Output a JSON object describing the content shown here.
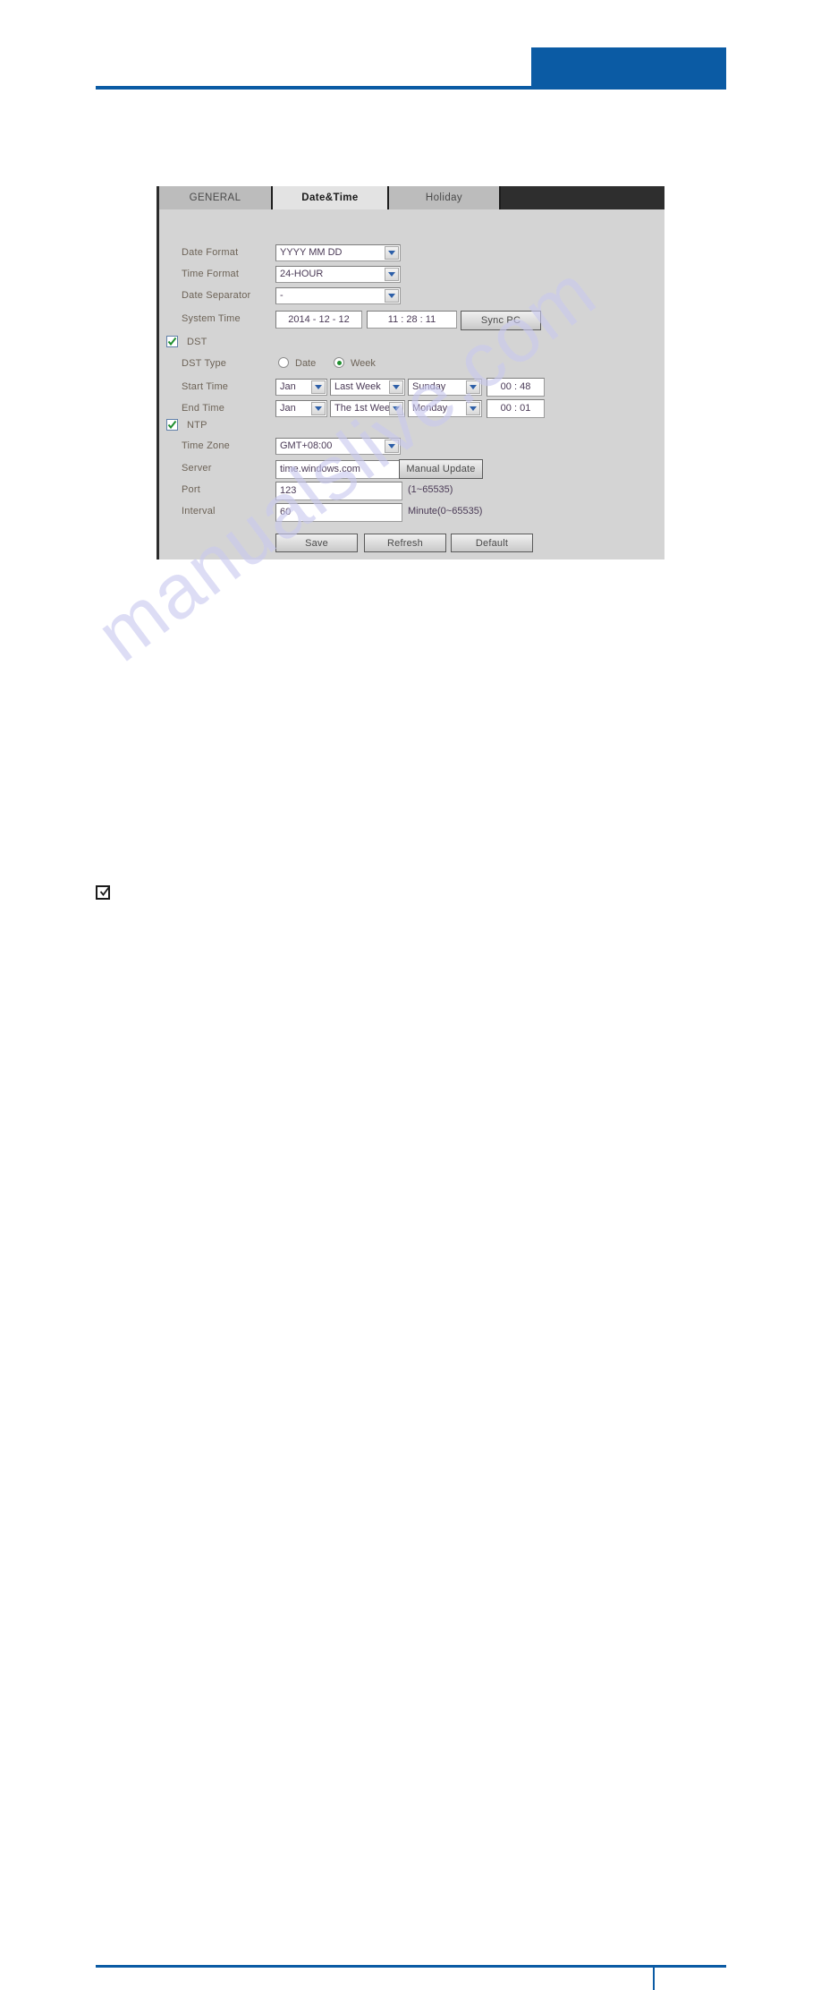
{
  "header": {
    "accent_color": "#0b5ba4"
  },
  "watermark": {
    "text": "manualslive.com"
  },
  "note": {
    "marker_icon": "checked-box-icon"
  },
  "ui": {
    "tabs": [
      {
        "label": "GENERAL",
        "active": false
      },
      {
        "label": "Date&Time",
        "active": true
      },
      {
        "label": "Holiday",
        "active": false
      }
    ],
    "fields": {
      "date_format_label": "Date Format",
      "date_format_value": "YYYY MM DD",
      "time_format_label": "Time Format",
      "time_format_value": "24-HOUR",
      "date_separator_label": "Date Separator",
      "date_separator_value": "-",
      "system_time_label": "System Time",
      "system_date_value": "2014 - 12 - 12",
      "system_clock_value": "11  :  28  :  11",
      "sync_pc_label": "Sync PC",
      "dst_label": "DST",
      "dst_checked": true,
      "dst_type_label": "DST Type",
      "dst_type_date_label": "Date",
      "dst_type_week_label": "Week",
      "dst_type_selected": "Week",
      "start_time_label": "Start Time",
      "start_month": "Jan",
      "start_week": "Last Week",
      "start_day": "Sunday",
      "start_clock": "00  :  48",
      "end_time_label": "End Time",
      "end_month": "Jan",
      "end_week": "The 1st Week",
      "end_day": "Monday",
      "end_clock": "00  :  01",
      "ntp_label": "NTP",
      "ntp_checked": true,
      "time_zone_label": "Time Zone",
      "time_zone_value": "GMT+08:00",
      "server_label": "Server",
      "server_value": "time.windows.com",
      "manual_update_label": "Manual Update",
      "port_label": "Port",
      "port_value": "123",
      "port_hint": "(1~65535)",
      "interval_label": "Interval",
      "interval_value": "60",
      "interval_hint": "Minute(0~65535)"
    },
    "buttons": {
      "save_label": "Save",
      "refresh_label": "Refresh",
      "default_label": "Default"
    }
  }
}
